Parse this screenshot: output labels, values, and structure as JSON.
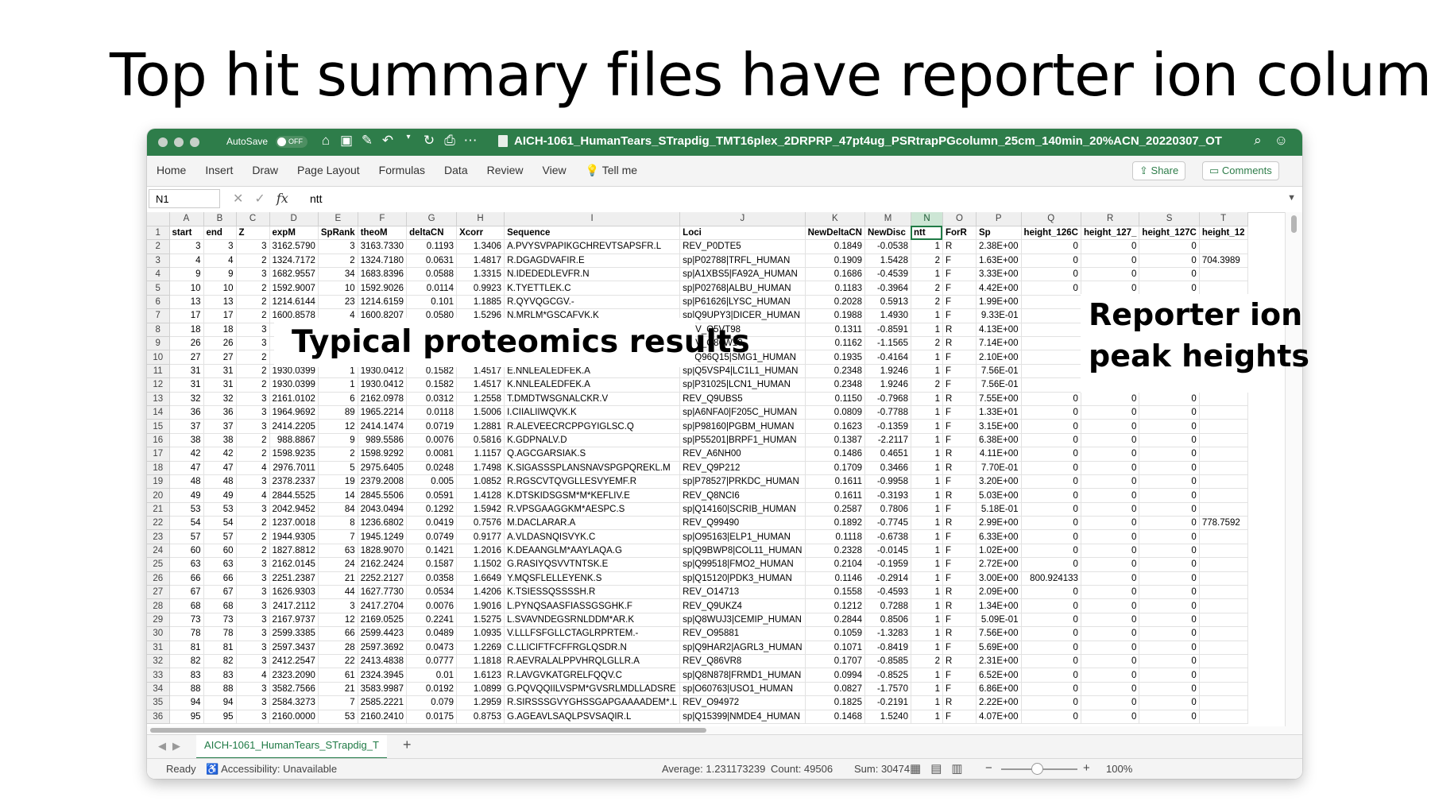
{
  "slide": {
    "title": "Top hit summary files have reporter ion columns"
  },
  "callouts": {
    "left": "Typical proteomics results",
    "right_line1": "Reporter ion",
    "right_line2": "peak heights"
  },
  "window": {
    "autosave_label": "AutoSave",
    "autosave_state": "OFF",
    "doc_title": "AICH-1061_HumanTears_STrapdig_TMT16plex_2DRPRP_47pt4ug_PSRtrapPGcolumn_25cm_140min_20%ACN_20220307_OT",
    "accent_color": "#2e7d4a"
  },
  "ribbon": {
    "tabs": [
      "Home",
      "Insert",
      "Draw",
      "Page Layout",
      "Formulas",
      "Data",
      "Review",
      "View",
      "Tell me"
    ],
    "share_label": "Share",
    "comments_label": "Comments"
  },
  "formula_bar": {
    "name_box": "N1",
    "content": "ntt"
  },
  "sheet": {
    "column_letters": [
      "A",
      "B",
      "C",
      "D",
      "E",
      "F",
      "G",
      "H",
      "I",
      "J",
      "K",
      "M",
      "N",
      "O",
      "P",
      "Q",
      "R",
      "S",
      "T"
    ],
    "selected_column": "N",
    "header_row": [
      "start",
      "end",
      "Z",
      "expM",
      "SpRank",
      "theoM",
      "deltaCN",
      "Xcorr",
      "Sequence",
      "Loci",
      "NewDeltaCN",
      "NewDisc",
      "ntt",
      "ForR",
      "Sp",
      "height_126C",
      "height_127_",
      "height_127C",
      "height_12"
    ],
    "rows": [
      [
        "2",
        "3",
        "3",
        "3",
        "3162.5790",
        "3",
        "3163.7330",
        "0.1193",
        "1.3406",
        "A.PVYSVPAPIKGCHREVTSAPSFR.L",
        "REV_P0DTE5",
        "0.1849",
        "-0.0538",
        "1",
        "R",
        "2.38E+00",
        "0",
        "0",
        "0",
        ""
      ],
      [
        "3",
        "4",
        "4",
        "2",
        "1324.7172",
        "2",
        "1324.7180",
        "0.0631",
        "1.4817",
        "R.DGAGDVAFIR.E",
        "sp|P02788|TRFL_HUMAN",
        "0.1909",
        "1.5428",
        "2",
        "F",
        "1.63E+00",
        "0",
        "0",
        "0",
        "704.3989"
      ],
      [
        "4",
        "9",
        "9",
        "3",
        "1682.9557",
        "34",
        "1683.8396",
        "0.0588",
        "1.3315",
        "N.IDEDEDLEVFR.N",
        "sp|A1XBS5|FA92A_HUMAN",
        "0.1686",
        "-0.4539",
        "1",
        "F",
        "3.33E+00",
        "0",
        "0",
        "0",
        ""
      ],
      [
        "5",
        "10",
        "10",
        "2",
        "1592.9007",
        "10",
        "1592.9026",
        "0.0114",
        "0.9923",
        "K.TYETTLEK.C",
        "sp|P02768|ALBU_HUMAN",
        "0.1183",
        "-0.3964",
        "2",
        "F",
        "4.42E+00",
        "0",
        "0",
        "0",
        ""
      ],
      [
        "6",
        "13",
        "13",
        "2",
        "1214.6144",
        "23",
        "1214.6159",
        "0.101",
        "1.1885",
        "R.QYVQGCGV.-",
        "sp|P61626|LYSC_HUMAN",
        "0.2028",
        "0.5913",
        "2",
        "F",
        "1.99E+00",
        "",
        "",
        "",
        ""
      ],
      [
        "7",
        "17",
        "17",
        "2",
        "1600.8578",
        "4",
        "1600.8207",
        "0.0580",
        "1.5296",
        "N.MRLM*GSCAFVK.K",
        "sp|Q9UPY3|DICER_HUMAN",
        "0.1988",
        "1.4930",
        "1",
        "F",
        "9.33E-01",
        "",
        "",
        "",
        ""
      ],
      [
        "8",
        "18",
        "18",
        "3",
        "",
        "",
        "",
        "",
        "",
        "",
        "REV_Q5VT98",
        "0.1311",
        "-0.8591",
        "1",
        "R",
        "4.13E+00",
        "",
        "",
        "",
        ""
      ],
      [
        "9",
        "26",
        "26",
        "3",
        "",
        "",
        "",
        "",
        "",
        "",
        "REV_Q86W10",
        "0.1162",
        "-1.1565",
        "2",
        "R",
        "7.14E+00",
        "",
        "",
        "",
        ""
      ],
      [
        "10",
        "27",
        "27",
        "2",
        "",
        "",
        "",
        "",
        "",
        "",
        "sp|Q96Q15|SMG1_HUMAN",
        "0.1935",
        "-0.4164",
        "1",
        "F",
        "2.10E+00",
        "",
        "",
        "",
        ""
      ],
      [
        "11",
        "31",
        "31",
        "2",
        "1930.0399",
        "1",
        "1930.0412",
        "0.1582",
        "1.4517",
        "E.NNLEALEDFEK.A",
        "sp|Q5VSP4|LC1L1_HUMAN",
        "0.2348",
        "1.9246",
        "1",
        "F",
        "7.56E-01",
        "",
        "",
        "",
        ""
      ],
      [
        "12",
        "31",
        "31",
        "2",
        "1930.0399",
        "1",
        "1930.0412",
        "0.1582",
        "1.4517",
        "K.NNLEALEDFEK.A",
        "sp|P31025|LCN1_HUMAN",
        "0.2348",
        "1.9246",
        "2",
        "F",
        "7.56E-01",
        "",
        "",
        "",
        ""
      ],
      [
        "13",
        "32",
        "32",
        "3",
        "2161.0102",
        "6",
        "2162.0978",
        "0.0312",
        "1.2558",
        "T.DMDTWSGNALCKR.V",
        "REV_Q9UBS5",
        "0.1150",
        "-0.7968",
        "1",
        "R",
        "7.55E+00",
        "0",
        "0",
        "0",
        ""
      ],
      [
        "14",
        "36",
        "36",
        "3",
        "1964.9692",
        "89",
        "1965.2214",
        "0.0118",
        "1.5006",
        "I.CIIALIIWQVK.K",
        "sp|A6NFA0|F205C_HUMAN",
        "0.0809",
        "-0.7788",
        "1",
        "F",
        "1.33E+01",
        "0",
        "0",
        "0",
        ""
      ],
      [
        "15",
        "37",
        "37",
        "3",
        "2414.2205",
        "12",
        "2414.1474",
        "0.0719",
        "1.2881",
        "R.ALEVEECRCPPGYIGLSC.Q",
        "sp|P98160|PGBM_HUMAN",
        "0.1623",
        "-0.1359",
        "1",
        "F",
        "3.15E+00",
        "0",
        "0",
        "0",
        ""
      ],
      [
        "16",
        "38",
        "38",
        "2",
        "988.8867",
        "9",
        "989.5586",
        "0.0076",
        "0.5816",
        "K.GDPNALV.D",
        "sp|P55201|BRPF1_HUMAN",
        "0.1387",
        "-2.2117",
        "1",
        "F",
        "6.38E+00",
        "0",
        "0",
        "0",
        ""
      ],
      [
        "17",
        "42",
        "42",
        "2",
        "1598.9235",
        "2",
        "1598.9292",
        "0.0081",
        "1.1157",
        "Q.AGCGARSIAK.S",
        "REV_A6NH00",
        "0.1486",
        "0.4651",
        "1",
        "R",
        "4.11E+00",
        "0",
        "0",
        "0",
        ""
      ],
      [
        "18",
        "47",
        "47",
        "4",
        "2976.7011",
        "5",
        "2975.6405",
        "0.0248",
        "1.7498",
        "K.SIGASSSPLANSNAVSPGPQREKL.M",
        "REV_Q9P212",
        "0.1709",
        "0.3466",
        "1",
        "R",
        "7.70E-01",
        "0",
        "0",
        "0",
        ""
      ],
      [
        "19",
        "48",
        "48",
        "3",
        "2378.2337",
        "19",
        "2379.2008",
        "0.005",
        "1.0852",
        "R.RGSCVTQVGLLESVYEMF.R",
        "sp|P78527|PRKDC_HUMAN",
        "0.1611",
        "-0.9958",
        "1",
        "F",
        "3.20E+00",
        "0",
        "0",
        "0",
        ""
      ],
      [
        "20",
        "49",
        "49",
        "4",
        "2844.5525",
        "14",
        "2845.5506",
        "0.0591",
        "1.4128",
        "K.DTSKIDSGSM*M*KEFLIV.E",
        "REV_Q8NCI6",
        "0.1611",
        "-0.3193",
        "1",
        "R",
        "5.03E+00",
        "0",
        "0",
        "0",
        ""
      ],
      [
        "21",
        "53",
        "53",
        "3",
        "2042.9452",
        "84",
        "2043.0494",
        "0.1292",
        "1.5942",
        "R.VPSGAAGGKM*AESPC.S",
        "sp|Q14160|SCRIB_HUMAN",
        "0.2587",
        "0.7806",
        "1",
        "F",
        "5.18E-01",
        "0",
        "0",
        "0",
        ""
      ],
      [
        "22",
        "54",
        "54",
        "2",
        "1237.0018",
        "8",
        "1236.6802",
        "0.0419",
        "0.7576",
        "M.DACLARAR.A",
        "REV_Q99490",
        "0.1892",
        "-0.7745",
        "1",
        "R",
        "2.99E+00",
        "0",
        "0",
        "0",
        "778.7592"
      ],
      [
        "23",
        "57",
        "57",
        "2",
        "1944.9305",
        "7",
        "1945.1249",
        "0.0749",
        "0.9177",
        "A.VLDASNQISVYK.C",
        "sp|O95163|ELP1_HUMAN",
        "0.1118",
        "-0.6738",
        "1",
        "F",
        "6.33E+00",
        "0",
        "0",
        "0",
        ""
      ],
      [
        "24",
        "60",
        "60",
        "2",
        "1827.8812",
        "63",
        "1828.9070",
        "0.1421",
        "1.2016",
        "K.DEAANGLM*AAYLAQA.G",
        "sp|Q9BWP8|COL11_HUMAN",
        "0.2328",
        "-0.0145",
        "1",
        "F",
        "1.02E+00",
        "0",
        "0",
        "0",
        ""
      ],
      [
        "25",
        "63",
        "63",
        "3",
        "2162.0145",
        "24",
        "2162.2424",
        "0.1587",
        "1.1502",
        "G.RASIYQSVVTNTSK.E",
        "sp|Q99518|FMO2_HUMAN",
        "0.2104",
        "-0.1959",
        "1",
        "F",
        "2.72E+00",
        "0",
        "0",
        "0",
        ""
      ],
      [
        "26",
        "66",
        "66",
        "3",
        "2251.2387",
        "21",
        "2252.2127",
        "0.0358",
        "1.6649",
        "Y.MQSFLELLEYENK.S",
        "sp|Q15120|PDK3_HUMAN",
        "0.1146",
        "-0.2914",
        "1",
        "F",
        "3.00E+00",
        "800.924133",
        "0",
        "0",
        ""
      ],
      [
        "27",
        "67",
        "67",
        "3",
        "1626.9303",
        "44",
        "1627.7730",
        "0.0534",
        "1.4206",
        "K.TSIESSQSSSSH.R",
        "REV_O14713",
        "0.1558",
        "-0.4593",
        "1",
        "R",
        "2.09E+00",
        "0",
        "0",
        "0",
        ""
      ],
      [
        "28",
        "68",
        "68",
        "3",
        "2417.2112",
        "3",
        "2417.2704",
        "0.0076",
        "1.9016",
        "L.PYNQSAASFIASSGSGHK.F",
        "REV_Q9UKZ4",
        "0.1212",
        "0.7288",
        "1",
        "R",
        "1.34E+00",
        "0",
        "0",
        "0",
        ""
      ],
      [
        "29",
        "73",
        "73",
        "3",
        "2167.9737",
        "12",
        "2169.0525",
        "0.2241",
        "1.5275",
        "L.SVAVNDEGSRNLDDM*AR.K",
        "sp|Q8WUJ3|CEMIP_HUMAN",
        "0.2844",
        "0.8506",
        "1",
        "F",
        "5.09E-01",
        "0",
        "0",
        "0",
        ""
      ],
      [
        "30",
        "78",
        "78",
        "3",
        "2599.3385",
        "66",
        "2599.4423",
        "0.0489",
        "1.0935",
        "V.LLLFSFGLLCTAGLRPRTEM.-",
        "REV_O95881",
        "0.1059",
        "-1.3283",
        "1",
        "R",
        "7.56E+00",
        "0",
        "0",
        "0",
        ""
      ],
      [
        "31",
        "81",
        "81",
        "3",
        "2597.3437",
        "28",
        "2597.3692",
        "0.0473",
        "1.2269",
        "C.LLICIFTFCFFRGLQSDR.N",
        "sp|Q9HAR2|AGRL3_HUMAN",
        "0.1071",
        "-0.8419",
        "1",
        "F",
        "5.69E+00",
        "0",
        "0",
        "0",
        ""
      ],
      [
        "32",
        "82",
        "82",
        "3",
        "2412.2547",
        "22",
        "2413.4838",
        "0.0777",
        "1.1818",
        "R.AEVRALALPPVHRQLGLLR.A",
        "REV_Q86VR8",
        "0.1707",
        "-0.8585",
        "2",
        "R",
        "2.31E+00",
        "0",
        "0",
        "0",
        ""
      ],
      [
        "33",
        "83",
        "83",
        "4",
        "2323.2090",
        "61",
        "2324.3945",
        "0.01",
        "1.6123",
        "R.LAVGVKATGRELFQQV.C",
        "sp|Q8N878|FRMD1_HUMAN",
        "0.0994",
        "-0.8525",
        "1",
        "F",
        "6.52E+00",
        "0",
        "0",
        "0",
        ""
      ],
      [
        "34",
        "88",
        "88",
        "3",
        "3582.7566",
        "21",
        "3583.9987",
        "0.0192",
        "1.0899",
        "G.PQVQQIILVSPM*GVSRLMDLLADSRE",
        "sp|O60763|USO1_HUMAN",
        "0.0827",
        "-1.7570",
        "1",
        "F",
        "6.86E+00",
        "0",
        "0",
        "0",
        ""
      ],
      [
        "35",
        "94",
        "94",
        "3",
        "2584.3273",
        "7",
        "2585.2221",
        "0.079",
        "1.2959",
        "R.SIRSSSGVYGHSSGAPGAAAADEM*.L",
        "REV_O94972",
        "0.1825",
        "-0.2191",
        "1",
        "R",
        "2.22E+00",
        "0",
        "0",
        "0",
        ""
      ],
      [
        "36",
        "95",
        "95",
        "3",
        "2160.0000",
        "53",
        "2160.2410",
        "0.0175",
        "0.8753",
        "G.AGEAVLSAQLPSVSAQIR.L",
        "sp|Q15399|NMDE4_HUMAN",
        "0.1468",
        "1.5240",
        "1",
        "F",
        "4.07E+00",
        "0",
        "0",
        "0",
        ""
      ]
    ]
  },
  "sheet_tab": {
    "name": "AICH-1061_HumanTears_STrapdig_T"
  },
  "status_bar": {
    "ready": "Ready",
    "accessibility": "Accessibility: Unavailable",
    "average": "Average: 1.231173239",
    "count": "Count: 49506",
    "sum": "Sum: 30474",
    "zoom": "100%"
  }
}
